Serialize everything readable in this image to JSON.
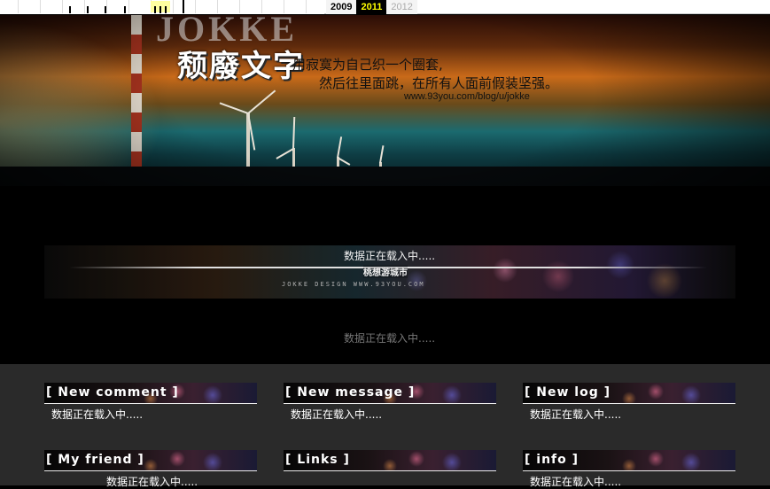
{
  "timeline": {
    "years": [
      {
        "label": "2009",
        "state": "prev"
      },
      {
        "label": "2011",
        "state": "current"
      },
      {
        "label": "2012",
        "state": "next"
      }
    ]
  },
  "banner": {
    "logo_latin": "JOKKE",
    "logo_chinese": "颓廢文字",
    "poem_line1": "用寂寞为自己织一个圈套,",
    "poem_line2": "然后往里面跳，在所有人面前假装坚强。",
    "poem_url": "www.93you.com/blog/u/jokke"
  },
  "band": {
    "loading_text": "数据正在载入中.....",
    "subtitle": "桃想游城市",
    "credit": "JOKKE DESIGN WWW.93YOU.COM"
  },
  "loading_text_2": "数据正在载入中.....",
  "modules": [
    {
      "title": "[ New comment ]",
      "body": "数据正在载入中....."
    },
    {
      "title": "[ New message ]",
      "body": "数据正在载入中....."
    },
    {
      "title": "[ New log ]",
      "body": "数据正在载入中....."
    },
    {
      "title": "[ My friend ]",
      "body": "数据正在载入中....."
    },
    {
      "title": "[ Links ]",
      "body": ""
    },
    {
      "title": "[ info ]",
      "body": "数据正在载入中....."
    }
  ],
  "colors": {
    "current_year": "#ffff00",
    "module_bg": "#2a2a2a"
  }
}
